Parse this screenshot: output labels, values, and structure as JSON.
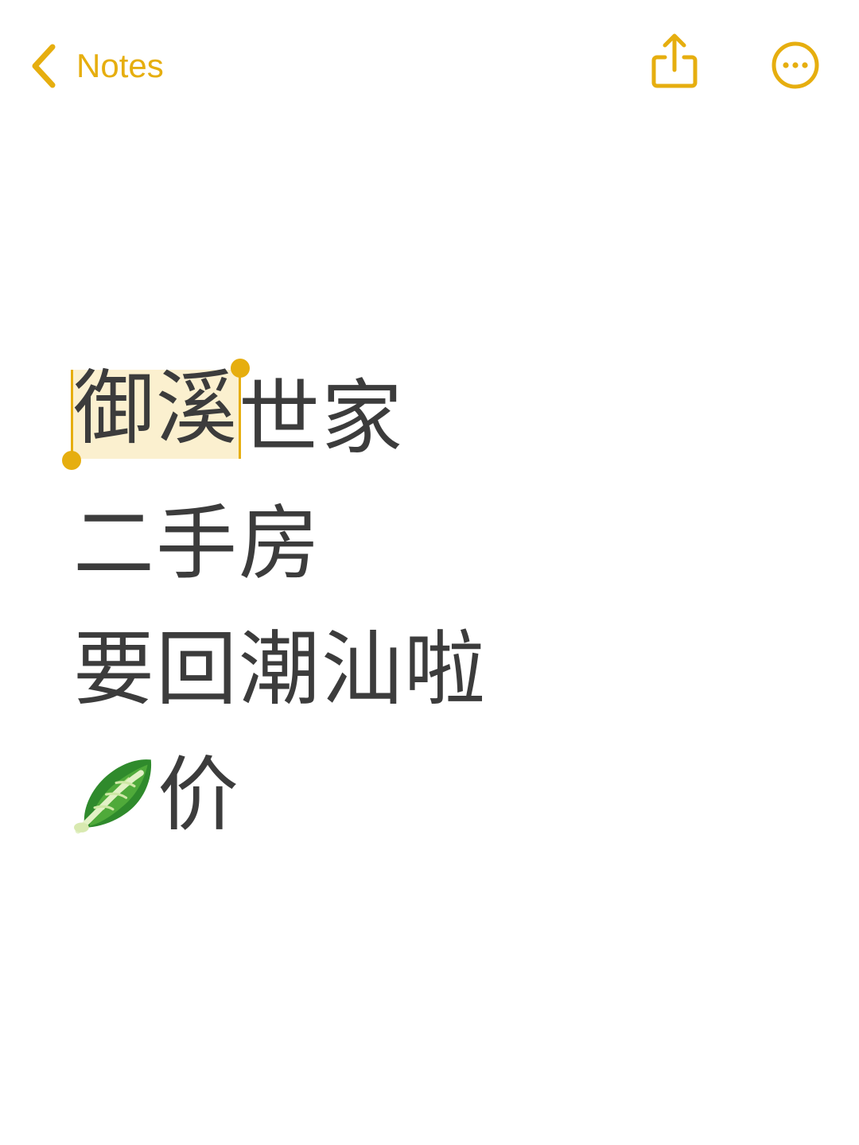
{
  "nav": {
    "back_label": "Notes",
    "back_icon": "chevron-left-icon",
    "share_icon": "share-icon",
    "more_icon": "ellipsis-circle-icon"
  },
  "colors": {
    "accent": "#e6ae0f",
    "text": "#3c3c3c",
    "selection_bg": "#fbf0cf",
    "background": "#ffffff"
  },
  "note": {
    "line1_selected": "御溪",
    "line1_rest": "世家",
    "line2": "二手房",
    "line3": "要回潮汕啦",
    "line4_emoji": "leafy-green-icon",
    "line4_text": "价"
  }
}
